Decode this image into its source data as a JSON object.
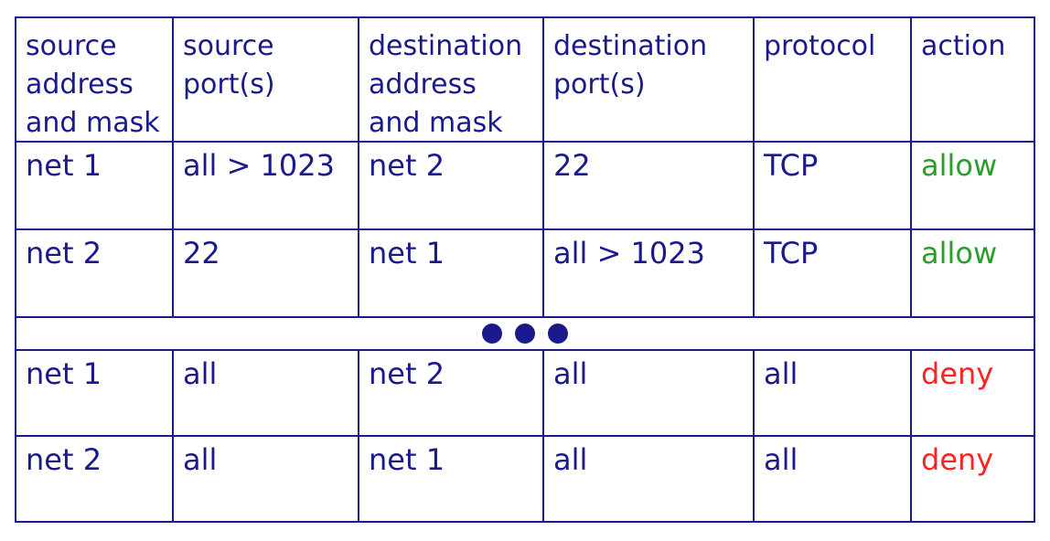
{
  "headers": [
    "source\naddress\nand mask",
    "source\nport(s)",
    "destination\naddress\nand mask",
    "destination\nport(s)",
    "protocol",
    "action"
  ],
  "rows": [
    [
      "net 1",
      "all > 1023",
      "net 2",
      "22",
      "TCP",
      "allow"
    ],
    [
      "net 2",
      "22",
      "net 1",
      "all > 1023",
      "TCP",
      "allow"
    ],
    [
      "net 1",
      "all",
      "net 2",
      "all",
      "all",
      "deny"
    ],
    [
      "net 2",
      "all",
      "net 1",
      "all",
      "all",
      "deny"
    ]
  ],
  "colors": {
    "text": "#1a1a8c",
    "allow": "#2a9d2a",
    "deny": "#ff2222"
  }
}
